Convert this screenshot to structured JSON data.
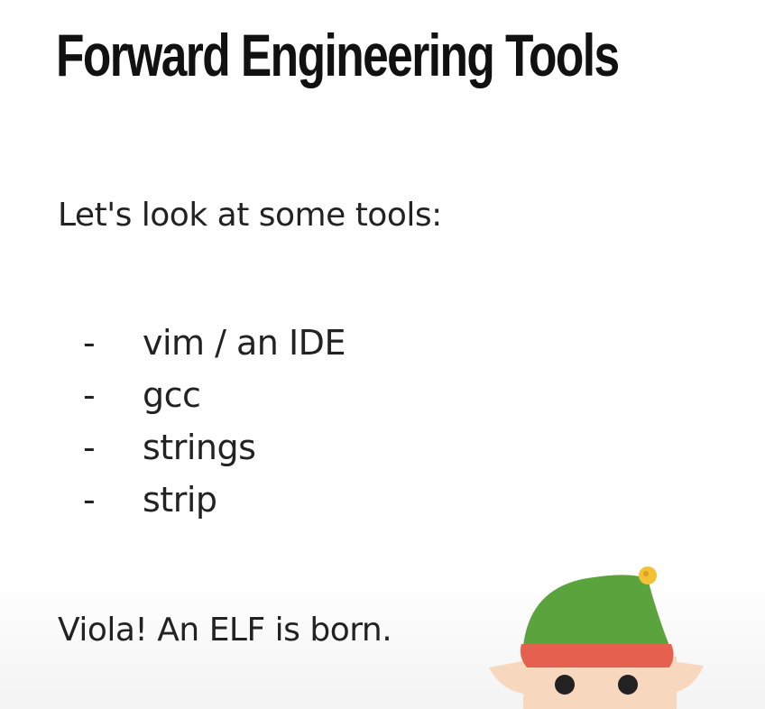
{
  "slide": {
    "title": "Forward Engineering Tools",
    "intro": "Let's look at some tools:",
    "bullet_marker": "-",
    "tools": [
      "vim / an IDE",
      "gcc",
      "strings",
      "strip"
    ],
    "outro": "Viola! An ELF is born."
  },
  "colors": {
    "text": "#222222",
    "elf_hat": "#5aa33d",
    "elf_hat_band": "#e5604f",
    "elf_bell": "#f2c234",
    "elf_skin": "#f8d7bf",
    "elf_eyes": "#222222"
  },
  "icons": {
    "mascot": "elf-icon"
  }
}
